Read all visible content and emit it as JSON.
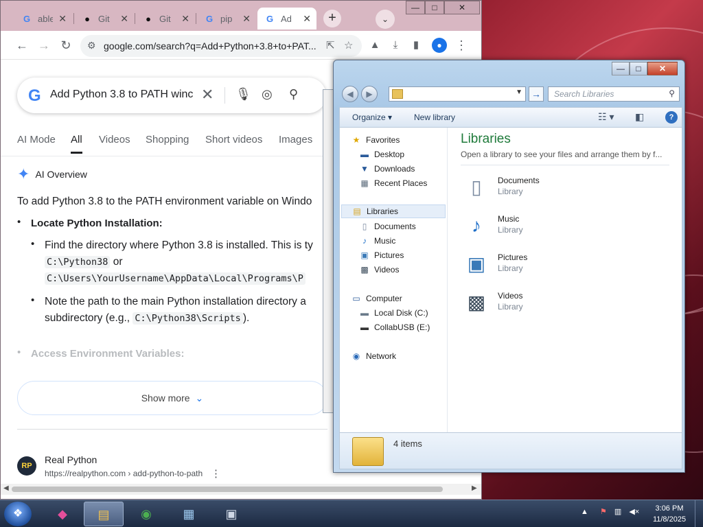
{
  "colors": {
    "chrome_frame": "#d8b7c2",
    "google_blue": "#1a73e8",
    "libraries_green": "#1e7a3a",
    "taskbar": "#1c2a42"
  },
  "chrome": {
    "tabs": [
      {
        "icon": "google-icon",
        "title": "able",
        "active": false
      },
      {
        "icon": "github-icon",
        "title": "Git",
        "active": false
      },
      {
        "icon": "github-icon",
        "title": "Git",
        "active": false
      },
      {
        "icon": "google-icon",
        "title": "pip",
        "active": false
      },
      {
        "icon": "google-icon",
        "title": "Ad",
        "active": true
      }
    ],
    "new_tab": "+",
    "tab_search": "⌄",
    "window_buttons": {
      "minimize": "—",
      "maximize": "□",
      "close": "✕"
    },
    "toolbar": {
      "back": "←",
      "forward": "→",
      "reload": "↻",
      "url": "google.com/search?q=Add+Python+3.8+to+PAT..."
    }
  },
  "google": {
    "query": "Add Python 3.8 to PATH winc",
    "tabs": [
      "AI Mode",
      "All",
      "Videos",
      "Shopping",
      "Short videos",
      "Images"
    ],
    "active_tab": "All",
    "ai_overview_label": "AI Overview",
    "intro": "To add Python 3.8 to the PATH environment variable on Windo",
    "step1_heading": "Locate Python Installation:",
    "bullet1_line1": "Find the directory where Python 3.8 is installed. This is ty",
    "bullet1_code1": "C:\\Python38",
    "bullet1_or": "or",
    "bullet1_code2": "C:\\Users\\YourUsername\\AppData\\Local\\Programs\\P",
    "bullet2_line1": "Note the path to the main Python installation directory a",
    "bullet2_line2_prefix": "subdirectory (e.g.,",
    "bullet2_code": "C:\\Python38\\Scripts",
    "bullet2_line2_suffix": ").",
    "step2_heading": "Access Environment Variables:",
    "show_more": "Show more",
    "result": {
      "site_name": "Real Python",
      "url": "https://realpython.com › add-python-to-path"
    }
  },
  "explorer": {
    "search_placeholder": "Search Libraries",
    "commands": {
      "organize": "Organize ▾",
      "new_library": "New library"
    },
    "nav": {
      "favorites": "Favorites",
      "desktop": "Desktop",
      "downloads": "Downloads",
      "recent_places": "Recent Places",
      "libraries": "Libraries",
      "documents": "Documents",
      "music": "Music",
      "pictures": "Pictures",
      "videos": "Videos",
      "computer": "Computer",
      "local_disk": "Local Disk (C:)",
      "usb": "CollabUSB (E:)",
      "network": "Network"
    },
    "content": {
      "title": "Libraries",
      "subtitle": "Open a library to see your files and arrange them by f...",
      "items": [
        {
          "name": "Documents",
          "type": "Library",
          "icon": "documents-library-icon"
        },
        {
          "name": "Music",
          "type": "Library",
          "icon": "music-library-icon"
        },
        {
          "name": "Pictures",
          "type": "Library",
          "icon": "pictures-library-icon"
        },
        {
          "name": "Videos",
          "type": "Library",
          "icon": "videos-library-icon"
        }
      ]
    },
    "status": "4 items"
  },
  "taskbar": {
    "time": "3:06 PM",
    "date": "11/8/2025",
    "tray_arrow": "▲"
  }
}
